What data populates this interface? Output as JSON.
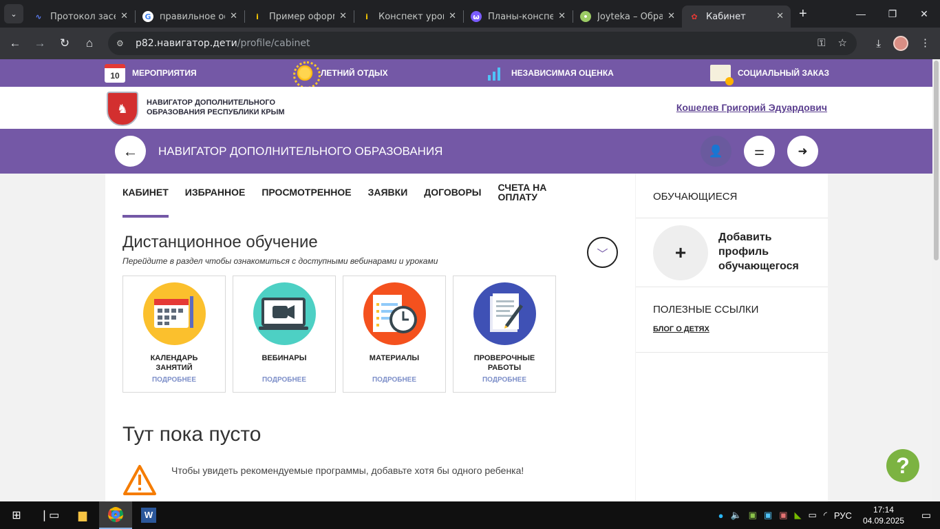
{
  "browser": {
    "tabs": [
      {
        "title": "Протокол засед",
        "icon": "wavy-icon",
        "color": "#5b7df5"
      },
      {
        "title": "правильное оф",
        "icon": "google-icon",
        "color": "#4285f4"
      },
      {
        "title": "Пример оформ",
        "icon": "info-icon",
        "color": "#f9c900"
      },
      {
        "title": "Конспект урока",
        "icon": "info-icon",
        "color": "#f9c900"
      },
      {
        "title": "Планы-конспек",
        "icon": "infourok-icon",
        "color": "#7a5cff"
      },
      {
        "title": "Joyteka – Обра",
        "icon": "bulb-icon",
        "color": "#9ccc65"
      },
      {
        "title": "Кабинет",
        "icon": "navigator-icon",
        "color": "#e53935",
        "active": true
      }
    ],
    "url_host": "p82.навигатор.дети",
    "url_path": "/profile/cabinet"
  },
  "top_menu": [
    {
      "label": "МЕРОПРИЯТИЯ",
      "icon": "calendar-icon",
      "num": "10"
    },
    {
      "label": "ЛЕТНИЙ ОТДЫХ",
      "icon": "sun-icon"
    },
    {
      "label": "НЕЗАВИСИМАЯ ОЦЕНКА",
      "icon": "growth-chart-icon"
    },
    {
      "label": "СОЦИАЛЬНЫЙ ЗАКАЗ",
      "icon": "certificate-icon"
    }
  ],
  "header": {
    "logo_line1": "НАВИГАТОР ДОПОЛНИТЕЛЬНОГО",
    "logo_line2": "ОБРАЗОВАНИЯ РЕСПУБЛИКИ КРЫМ",
    "user_name": "Кошелев Григорий Эдуардович"
  },
  "band": {
    "title": "НАВИГАТОР ДОПОЛНИТЕЛЬНОГО ОБРАЗОВАНИЯ"
  },
  "cabinet_tabs": [
    {
      "label": "КАБИНЕТ",
      "active": true
    },
    {
      "label": "ИЗБРАННОЕ"
    },
    {
      "label": "ПРОСМОТРЕННОЕ"
    },
    {
      "label": "ЗАЯВКИ"
    },
    {
      "label": "ДОГОВОРЫ"
    },
    {
      "label": "СЧЕТА НА ОПЛАТУ"
    }
  ],
  "distance": {
    "title": "Дистанционное обучение",
    "subtitle": "Перейдите в раздел чтобы ознакомиться с доступными вебинарами и уроками"
  },
  "cards": [
    {
      "label_1": "КАЛЕНДАРЬ",
      "label_2": "ЗАНЯТИЙ",
      "more": "ПОДРОБНЕЕ",
      "icon": "calendar-icon",
      "color": "#fbc02d"
    },
    {
      "label_1": "ВЕБИНАРЫ",
      "label_2": "",
      "more": "ПОДРОБНЕЕ",
      "icon": "camera-icon",
      "color": "#4dd0c4"
    },
    {
      "label_1": "МАТЕРИАЛЫ",
      "label_2": "",
      "more": "ПОДРОБНЕЕ",
      "icon": "clock-document-icon",
      "color": "#f4511e"
    },
    {
      "label_1": "ПРОВЕРОЧНЫЕ",
      "label_2": "РАБОТЫ",
      "more": "ПОДРОБНЕЕ",
      "icon": "test-paper-icon",
      "color": "#3f51b5"
    }
  ],
  "empty": {
    "title": "Тут пока пусто",
    "message": "Чтобы увидеть рекомендуемые программы, добавьте хотя бы одного ребенка!"
  },
  "sidebar": {
    "students_title": "ОБУЧАЮЩИЕСЯ",
    "add_plus": "+",
    "add_line1": "Добавить",
    "add_line2": "профиль",
    "add_line3": "обучающегося",
    "links_title": "ПОЛЕЗНЫЕ ССЫЛКИ",
    "blog": "БЛОГ О ДЕТЯХ"
  },
  "help": "?",
  "taskbar": {
    "lang": "РУС",
    "time": "17:14",
    "date": "04.09.2025"
  }
}
